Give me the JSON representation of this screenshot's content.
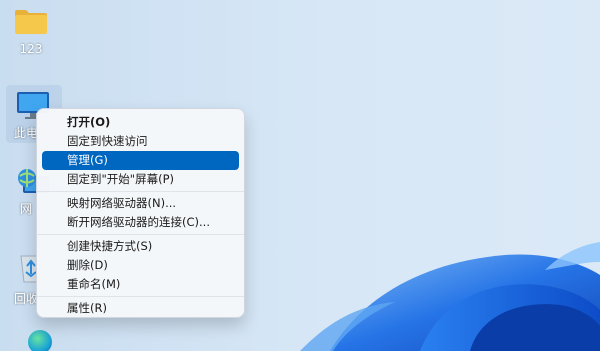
{
  "desktop": {
    "icons": [
      {
        "label": "123",
        "icon": "folder-icon"
      },
      {
        "label": "此电",
        "icon": "monitor-icon"
      },
      {
        "label": "网",
        "icon": "network-icon"
      },
      {
        "label": "回收",
        "icon": "recycle-bin-icon"
      }
    ],
    "colors": {
      "accent": "#0067c0",
      "wallpaper_blue": "#1a62e0"
    }
  },
  "context_menu": {
    "groups": [
      [
        {
          "label": "打开(O)",
          "bold": true
        },
        {
          "label": "固定到快速访问"
        },
        {
          "label": "管理(G)",
          "active": true
        },
        {
          "label": "固定到\"开始\"屏幕(P)"
        }
      ],
      [
        {
          "label": "映射网络驱动器(N)..."
        },
        {
          "label": "断开网络驱动器的连接(C)..."
        }
      ],
      [
        {
          "label": "创建快捷方式(S)"
        },
        {
          "label": "删除(D)"
        },
        {
          "label": "重命名(M)"
        }
      ],
      [
        {
          "label": "属性(R)"
        }
      ]
    ]
  }
}
